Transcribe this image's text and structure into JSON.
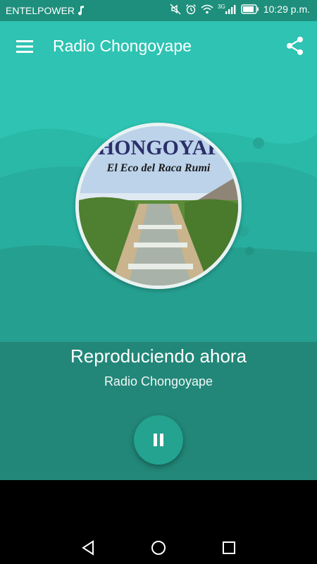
{
  "status_bar": {
    "carrier": "ENTELPOWER",
    "network": "3G",
    "time": "10:29 p.m.",
    "icons": [
      "music-note-icon",
      "mute-icon",
      "alarm-icon",
      "wifi-icon",
      "signal-icon",
      "battery-icon"
    ]
  },
  "app_bar": {
    "title": "Radio Chongoyape",
    "icons": [
      "menu-icon",
      "share-icon"
    ]
  },
  "artwork": {
    "banner_title": "CHONGOYAPE",
    "banner_subtitle": "El Eco del Raca Rumi"
  },
  "player": {
    "now_playing_label": "Reproduciendo ahora",
    "station_name": "Radio Chongoyape",
    "control_icon": "pause-icon"
  },
  "nav_bar": {
    "icons": [
      "back-icon",
      "home-icon",
      "recents-icon"
    ]
  },
  "colors": {
    "status_bar": "#1d8f7c",
    "primary": "#2ec3b2",
    "player_bg": "#228778",
    "button": "#23a390"
  }
}
